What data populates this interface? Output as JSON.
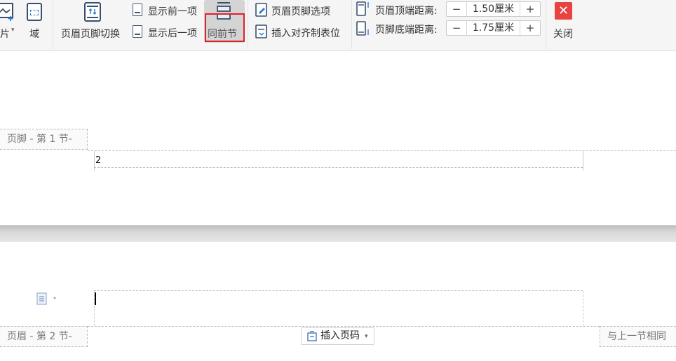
{
  "ribbon": {
    "picture_label": "片",
    "field_label": "域",
    "header_footer_switch_label": "页眉页脚切换",
    "show_previous_label": "显示前一项",
    "show_next_label": "显示后一项",
    "same_as_previous_label": "同前节",
    "header_footer_options_label": "页眉页脚选项",
    "insert_align_tab_label": "插入对齐制表位",
    "header_top_distance": {
      "label": "页眉顶端距离:",
      "value": "1.50厘米",
      "minus": "−",
      "plus": "+"
    },
    "footer_bottom_distance": {
      "label": "页脚底端距离:",
      "value": "1.75厘米",
      "minus": "−",
      "plus": "+"
    },
    "close_label": "关闭"
  },
  "page1": {
    "footer_tag": "页脚 - 第 1 节-",
    "page_number": "2"
  },
  "page2": {
    "header_tag": "页眉 - 第 2 节-",
    "insert_page_number_label": "插入页码",
    "same_as_previous_tag": "与上一节相同"
  },
  "colors": {
    "ribbon_bg": "#f5f5f5",
    "highlight_border": "#e0202a",
    "close_bg": "#e8433f",
    "accent_blue": "#2f7fd8"
  },
  "icons": [
    "picture-icon",
    "field-icon",
    "header-footer-switch-icon",
    "show-previous-icon",
    "show-next-icon",
    "same-as-previous-icon",
    "header-footer-options-icon",
    "align-tab-icon",
    "header-distance-icon",
    "footer-distance-icon",
    "close-icon",
    "paragraph-layout-icon",
    "page-number-icon"
  ]
}
